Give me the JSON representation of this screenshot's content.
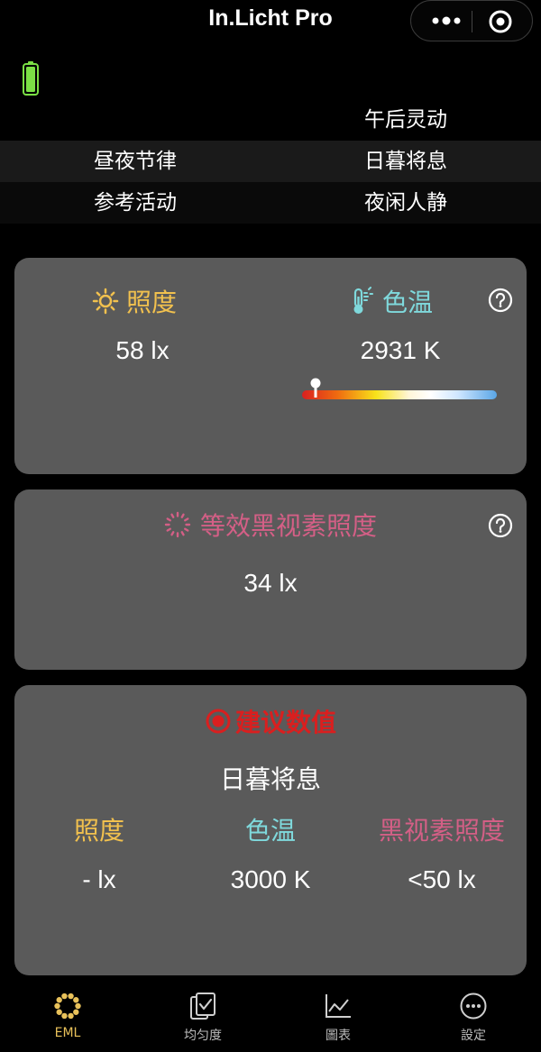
{
  "header": {
    "title": "In.Licht Pro",
    "more_icon": "more-dots-icon",
    "target_icon": "target-icon"
  },
  "status": {
    "battery_icon": "battery-full-icon",
    "battery_color": "#7be045"
  },
  "modes": {
    "row1_right": "午后灵动",
    "row2_left": "昼夜节律",
    "row2_right": "日暮将息",
    "row3_left": "参考活动",
    "row3_right": "夜闲人静"
  },
  "illuminance": {
    "label": "照度",
    "icon": "sun-icon",
    "value": "58 lx",
    "color": "#f2c14e"
  },
  "color_temp": {
    "label": "色温",
    "icon": "thermometer-icon",
    "value": "2931 K",
    "color": "#7fd9dc",
    "scale_position": 0.07
  },
  "eml": {
    "label": "等效黑视素照度",
    "icon": "dotted-ring-icon",
    "value": "34 lx",
    "color": "#d45f86"
  },
  "recommendation": {
    "title": "建议数值",
    "icon": "recommend-ring-icon",
    "mode": "日暮将息",
    "lux_label": "照度",
    "lux_value": "- lx",
    "cct_label": "色温",
    "cct_value": "3000 K",
    "eml_label": "黑视素照度",
    "eml_value": "<50 lx",
    "title_color": "#d91f1f"
  },
  "tabs": [
    {
      "label": "EML",
      "icon": "ring-dots-icon",
      "active": true
    },
    {
      "label": "均匀度",
      "icon": "doc-check-icon",
      "active": false
    },
    {
      "label": "圖表",
      "icon": "line-chart-icon",
      "active": false
    },
    {
      "label": "設定",
      "icon": "ellipsis-circle-icon",
      "active": false
    }
  ],
  "help_icon": "help-circle-icon"
}
